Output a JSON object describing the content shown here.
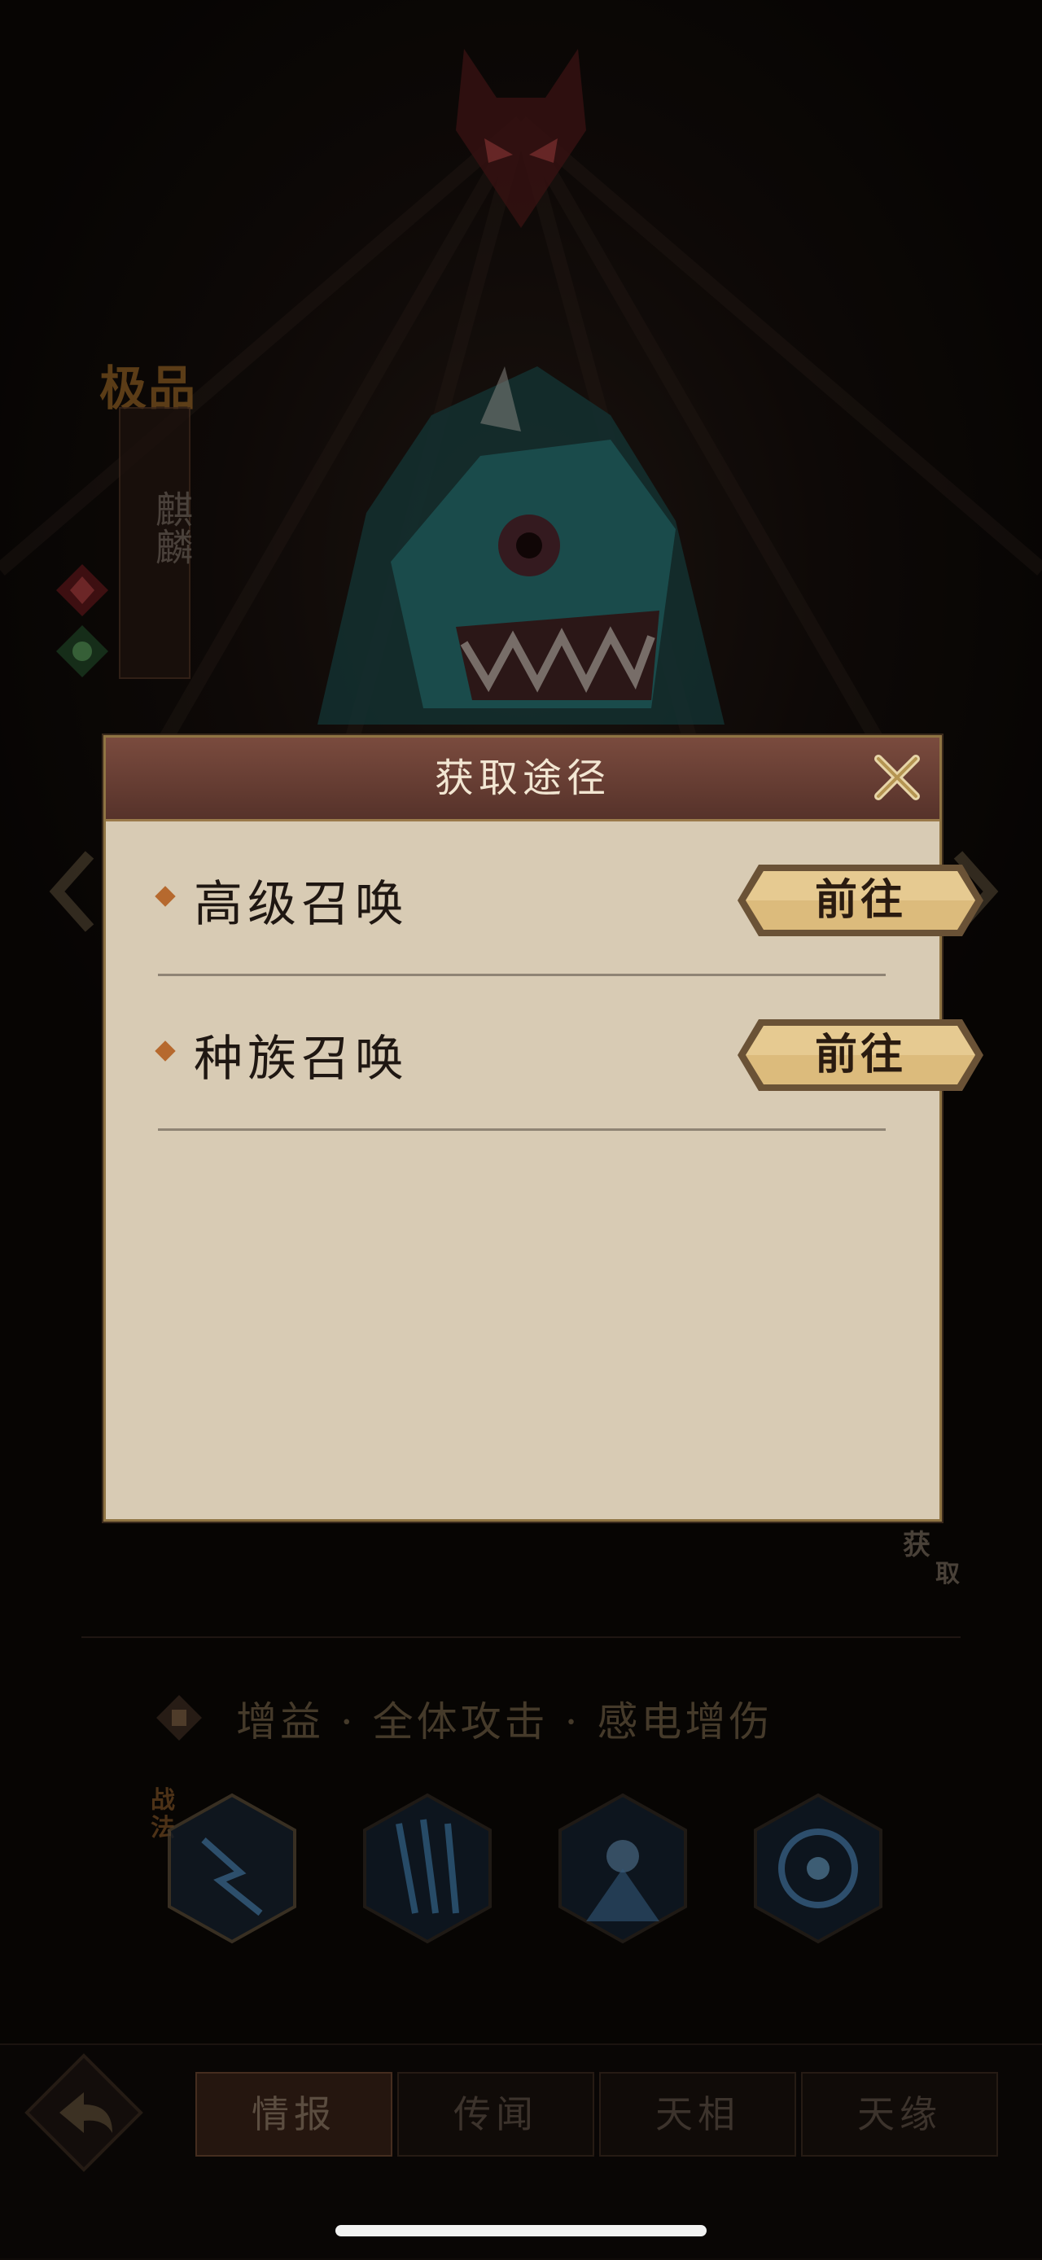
{
  "hero": {
    "grade": "极品",
    "name": "麒麟"
  },
  "acquire_mark": {
    "char1": "获",
    "char2": "取"
  },
  "traits": {
    "text": "增益 · 全体攻击 · 感电增伤",
    "skill_tag": "战法"
  },
  "skills": [
    {
      "icon": "lightning-warrior-skill-icon"
    },
    {
      "icon": "claw-lightning-skill-icon"
    },
    {
      "icon": "blue-summon-skill-icon"
    },
    {
      "icon": "electric-orb-skill-icon"
    }
  ],
  "tabs": [
    {
      "label": "情报",
      "active": true
    },
    {
      "label": "传闻",
      "active": false
    },
    {
      "label": "天相",
      "active": false
    },
    {
      "label": "天缘",
      "active": false
    }
  ],
  "dialog": {
    "title": "获取途径",
    "rows": [
      {
        "label": "高级召唤",
        "button": "前往"
      },
      {
        "label": "种族召唤",
        "button": "前往"
      }
    ]
  },
  "colors": {
    "dialog_bg": "#d8cbb4",
    "header": "#6a3f34",
    "button_gold": "#d9b574",
    "accent": "#b6692e"
  }
}
